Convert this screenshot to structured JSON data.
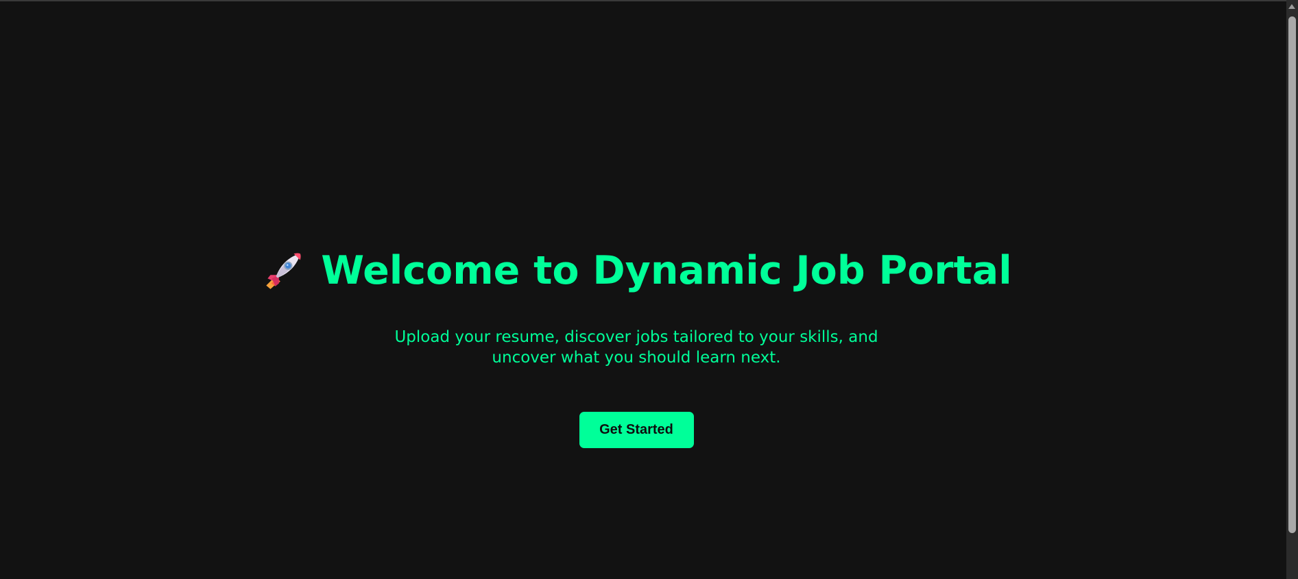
{
  "theme": {
    "accent": "#00ff99",
    "background": "#121212"
  },
  "hero": {
    "icon": "rocket-icon",
    "title": "Welcome to Dynamic Job Portal",
    "subtitle": "Upload your resume, discover jobs tailored to your skills, and uncover what you should learn next.",
    "cta_label": "Get Started"
  },
  "scrollbar": {
    "icon": "scroll-up-arrow-icon"
  }
}
